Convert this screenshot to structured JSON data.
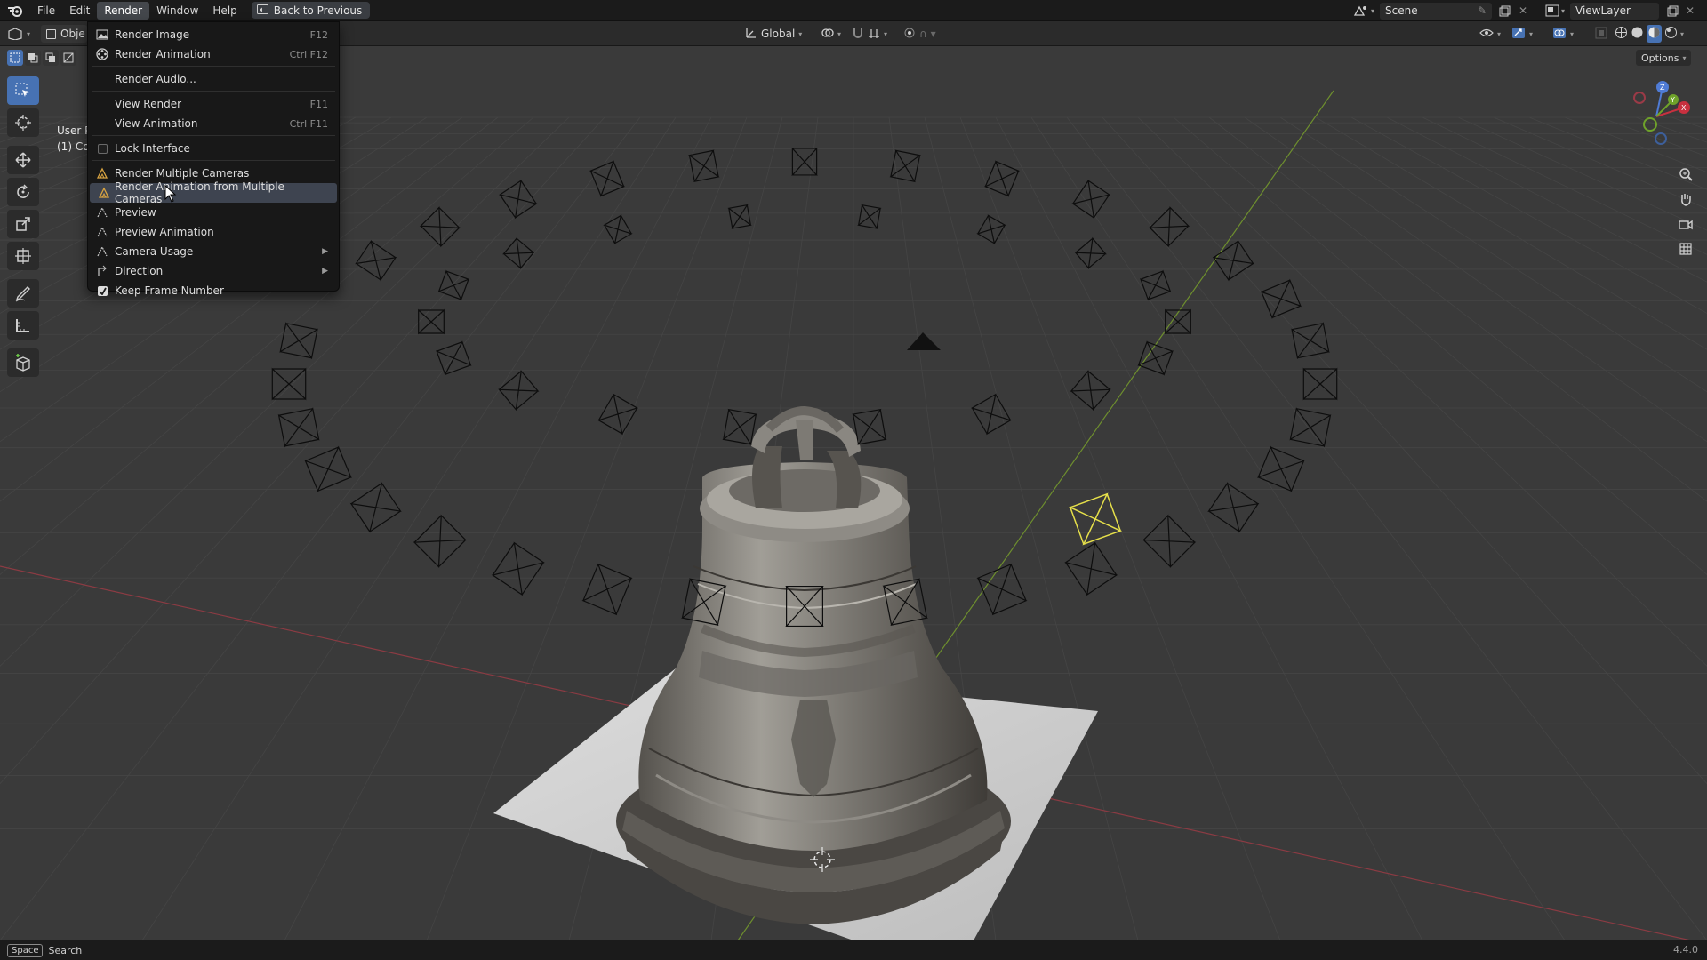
{
  "menubar": {
    "items": [
      {
        "label": "File"
      },
      {
        "label": "Edit"
      },
      {
        "label": "Render"
      },
      {
        "label": "Window"
      },
      {
        "label": "Help"
      }
    ],
    "back_button": "Back to Previous"
  },
  "topright": {
    "scene": "Scene",
    "view_layer": "ViewLayer"
  },
  "header": {
    "mode": "Obje",
    "transform_orientation": "Global",
    "options": "Options"
  },
  "viewport": {
    "view_name": "User P",
    "collection": "(1) Co"
  },
  "render_menu": {
    "items": [
      {
        "label": "Render Image",
        "shortcut": "F12",
        "icon": "render-image-icon"
      },
      {
        "label": "Render Animation",
        "shortcut": "Ctrl F12",
        "icon": "render-animation-icon"
      },
      {
        "label": "Render Audio...",
        "shortcut": ""
      },
      {
        "label": "View Render",
        "shortcut": "F11"
      },
      {
        "label": "View Animation",
        "shortcut": "Ctrl F11"
      },
      {
        "label": "Lock Interface",
        "checked": false
      },
      {
        "label": "Render Multiple Cameras",
        "icon": "camera-multi-icon"
      },
      {
        "label": "Render Animation from Multiple Cameras",
        "icon": "camera-multi-icon",
        "highlighted": true
      },
      {
        "label": "Preview",
        "icon": "camera-preview-icon"
      },
      {
        "label": "Preview Animation",
        "icon": "camera-preview-icon"
      },
      {
        "label": "Camera Usage",
        "icon": "camera-usage-icon",
        "submenu": true
      },
      {
        "label": "Direction",
        "icon": "direction-icon",
        "submenu": true
      },
      {
        "label": "Keep Frame Number",
        "checked": true
      }
    ]
  },
  "statusbar": {
    "key": "Space",
    "action": "Search",
    "version": "4.4.0"
  },
  "colors": {
    "accent": "#4772b3",
    "menu_highlight": "#3e4450",
    "grid_line": "#454545",
    "x_axis": "#8b3b43",
    "y_axis": "#6e8f2e",
    "selected_camera": "#e6e04a"
  }
}
